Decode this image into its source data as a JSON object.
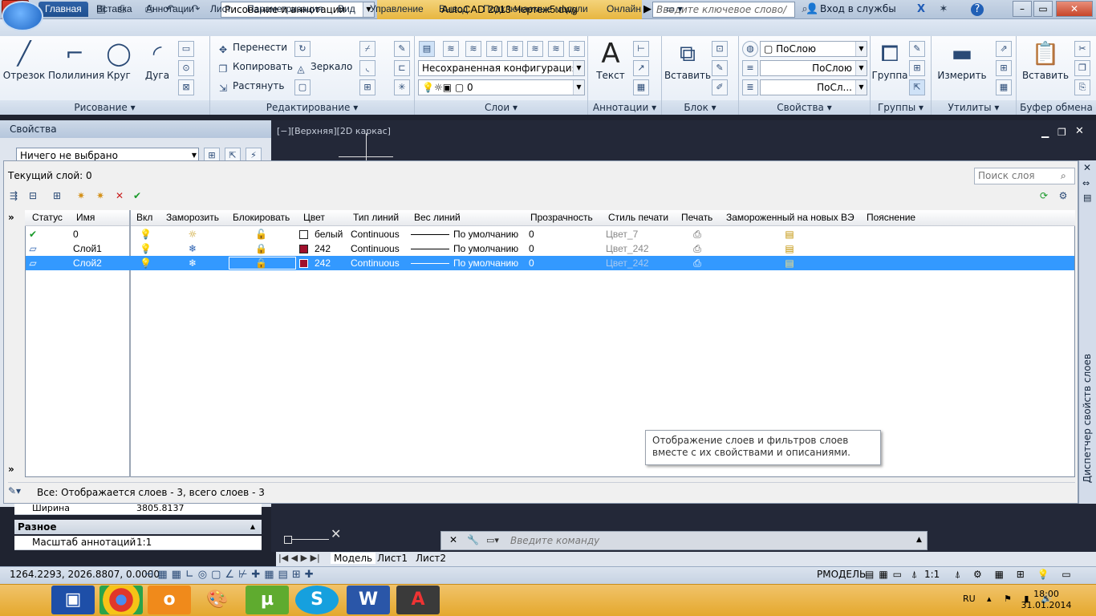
{
  "titlebar": {
    "logo_letter": "A",
    "workspace": "Рисование и аннотации",
    "title": "AutoCAD 2013    Чертеж5.dwg",
    "search_placeholder": "Введите ключевое слово/фразу",
    "login": "Вход в службы",
    "help": "?"
  },
  "ribbon_tabs": [
    "Главная",
    "Вставка",
    "Аннотации",
    "Лист",
    "Параметризация",
    "Вид",
    "Управление",
    "Вывод",
    "Подключаемые модули",
    "Онлайн"
  ],
  "ribbon": {
    "draw": {
      "label": "Рисование",
      "line": "Отрезок",
      "polyline": "Полилиния",
      "circle": "Круг",
      "arc": "Дуга"
    },
    "modify": {
      "label": "Редактирование",
      "move": "Перенести",
      "copy": "Копировать",
      "stretch": "Растянуть",
      "mirror": "Зеркало"
    },
    "layers": {
      "label": "Слои",
      "state": "Несохраненная конфигурация сло",
      "current": "0"
    },
    "annotation": {
      "label": "Аннотации",
      "text": "Текст"
    },
    "block": {
      "label": "Блок",
      "insert": "Вставить"
    },
    "properties": {
      "label": "Свойства",
      "color": "ПоСлою",
      "linetype": "ПоСлою",
      "lineweight": "ПоСл..."
    },
    "groups": {
      "label": "Группы",
      "group": "Группа"
    },
    "utilities": {
      "label": "Утилиты",
      "measure": "Измерить"
    },
    "clipboard": {
      "label": "Буфер обмена",
      "paste": "Вставить"
    }
  },
  "properties_palette": {
    "title": "Свойства",
    "selection": "Ничего не выбрано",
    "width_label": "Ширина",
    "width_value": "3805.8137",
    "misc_header": "Разное",
    "annoscale_label": "Масштаб аннотаций",
    "annoscale_value": "1:1"
  },
  "viewport": {
    "label": "[−][Верхняя][2D каркас]"
  },
  "layer_manager": {
    "current_layer": "Текущий слой: 0",
    "search_placeholder": "Поиск слоя",
    "side_title": "Диспетчер свойств слоев",
    "columns": [
      "Статус",
      "Имя",
      "Вкл",
      "Заморозить",
      "Блокировать",
      "Цвет",
      "Тип линий",
      "Вес линий",
      "Прозрачность",
      "Стиль печати",
      "Печать",
      "Замороженный на новых ВЭ",
      "Пояснение"
    ],
    "rows": [
      {
        "name": "0",
        "color_name": "белый",
        "color_hex": "#ffffff",
        "linetype": "Continuous",
        "lineweight": "По умолчанию",
        "transparency": "0",
        "plotstyle": "Цвет_7",
        "current": true,
        "selected": false,
        "frozen": false,
        "locked": false
      },
      {
        "name": "Слой1",
        "color_name": "242",
        "color_hex": "#a0102c",
        "linetype": "Continuous",
        "lineweight": "По умолчанию",
        "transparency": "0",
        "plotstyle": "Цвет_242",
        "current": false,
        "selected": false,
        "frozen": true,
        "locked": true
      },
      {
        "name": "Слой2",
        "color_name": "242",
        "color_hex": "#a0102c",
        "linetype": "Continuous",
        "lineweight": "По умолчанию",
        "transparency": "0",
        "plotstyle": "Цвет_242",
        "current": false,
        "selected": true,
        "frozen": true,
        "locked": true
      }
    ],
    "status_text": "Все: Отображается слоев - 3, всего слоев - 3",
    "tooltip": "Отображение слоев и фильтров слоев вместе с их свойствами и описаниями."
  },
  "command_line": {
    "placeholder": "Введите команду"
  },
  "layout_tabs": [
    "Модель",
    "Лист1",
    "Лист2"
  ],
  "statusbar": {
    "coords": "1264.2293, 2026.8807, 0.0000",
    "space": "РМОДЕЛЬ",
    "scale": "1:1"
  },
  "taskbar": {
    "lang": "RU",
    "time": "18:00",
    "date": "31.01.2014"
  },
  "colors": {
    "accent": "#3399ff",
    "title_bar": "#e7b640",
    "taskbar": "#e4a82d"
  }
}
